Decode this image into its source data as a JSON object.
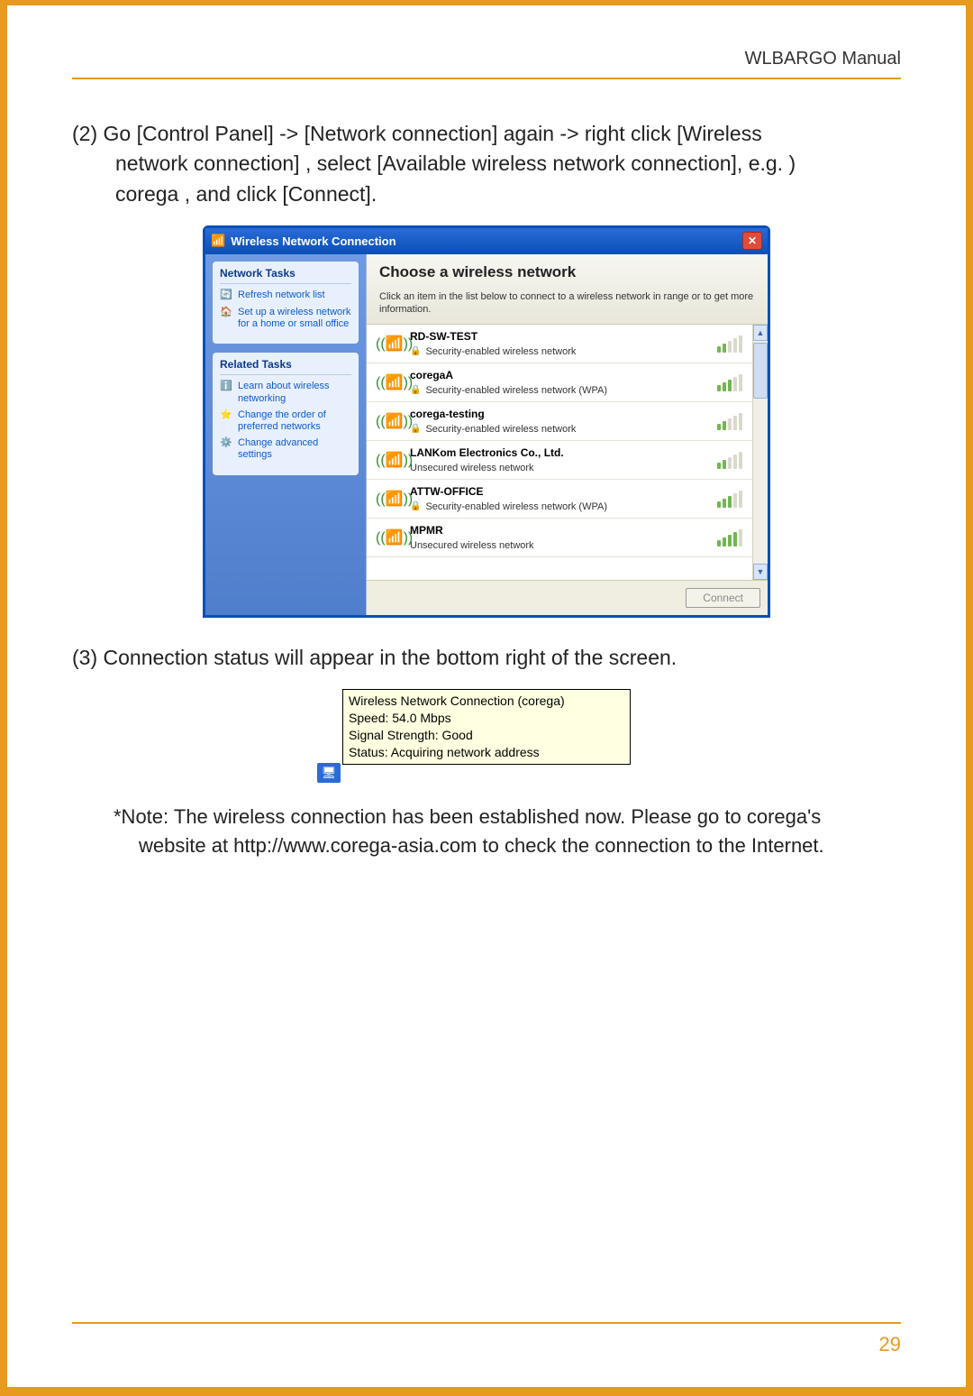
{
  "header": {
    "title": "WLBARGO Manual"
  },
  "page_number": "29",
  "steps": {
    "s2_line1": "(2) Go [Control Panel] -> [Network connection] again -> right click [Wireless",
    "s2_line2": "network connection] , select [Available wireless network connection],  e.g. )",
    "s2_line3": "corega , and click [Connect].",
    "s3": "(3) Connection status will appear in the bottom right of the screen."
  },
  "note": {
    "label": "*Note:",
    "line1": "The wireless connection has been established now. Please go to corega's",
    "line2": "website at http://www.corega-asia.com to check the connection to the Internet."
  },
  "dialog": {
    "title": "Wireless Network Connection",
    "side": {
      "tasks_heading": "Network Tasks",
      "refresh": "Refresh network list",
      "setup": "Set up a wireless network for a home or small office",
      "related_heading": "Related Tasks",
      "learn": "Learn about wireless networking",
      "order": "Change the order of preferred networks",
      "advanced": "Change advanced settings"
    },
    "main": {
      "heading": "Choose a wireless network",
      "sub": "Click an item in the list below to connect to a wireless network in range or to get more information.",
      "connect": "Connect"
    },
    "networks": [
      {
        "name": "RD-SW-TEST",
        "security": "Security-enabled wireless network",
        "lock": true,
        "bars": 2
      },
      {
        "name": "coregaA",
        "security": "Security-enabled wireless network (WPA)",
        "lock": true,
        "bars": 3
      },
      {
        "name": "corega-testing",
        "security": "Security-enabled wireless network",
        "lock": true,
        "bars": 2
      },
      {
        "name": "LANKom Electronics Co., Ltd.",
        "security": "Unsecured wireless network",
        "lock": false,
        "bars": 2
      },
      {
        "name": "ATTW-OFFICE",
        "security": "Security-enabled wireless network (WPA)",
        "lock": true,
        "bars": 3
      },
      {
        "name": "MPMR",
        "security": "Unsecured wireless network",
        "lock": false,
        "bars": 4
      }
    ]
  },
  "tooltip": {
    "l1": "Wireless Network Connection (corega)",
    "l2": "Speed: 54.0 Mbps",
    "l3": "Signal Strength: Good",
    "l4": "Status: Acquiring network address"
  }
}
